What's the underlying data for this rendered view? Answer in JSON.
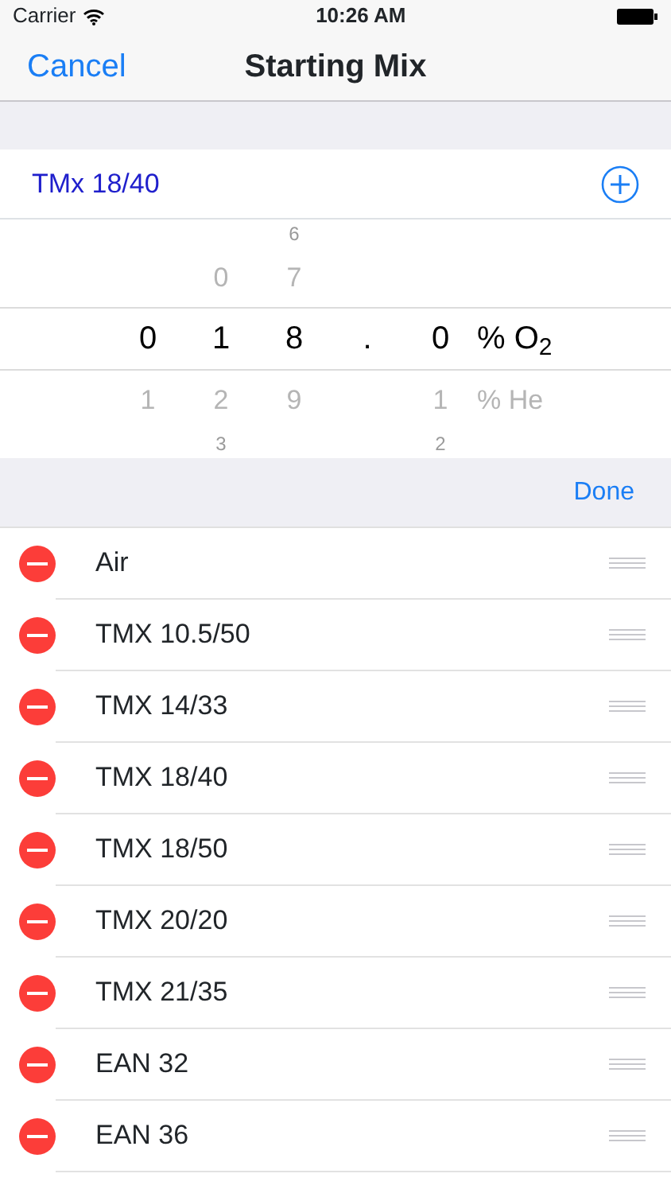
{
  "status_bar": {
    "carrier": "Carrier",
    "time": "10:26 AM"
  },
  "nav": {
    "cancel": "Cancel",
    "title": "Starting Mix"
  },
  "current_mix": {
    "label": "TMx 18/40"
  },
  "picker": {
    "rows": [
      {
        "kind": "far",
        "cells": [
          "",
          "",
          "6",
          "",
          "",
          ""
        ]
      },
      {
        "kind": "near",
        "cells": [
          "",
          "0",
          "7",
          "",
          "",
          ""
        ]
      },
      {
        "kind": "center",
        "cells": [
          "0",
          "1",
          "8",
          ".",
          "0",
          "% O$_{2}$"
        ]
      },
      {
        "kind": "near",
        "cells": [
          "1",
          "2",
          "9",
          "",
          "1",
          "% He"
        ]
      },
      {
        "kind": "far",
        "cells": [
          "",
          "3",
          "",
          "",
          "2",
          ""
        ]
      }
    ]
  },
  "list_header": {
    "done": "Done"
  },
  "mixes": [
    {
      "name": "Air"
    },
    {
      "name": "TMX 10.5/50"
    },
    {
      "name": "TMX 14/33"
    },
    {
      "name": "TMX 18/40"
    },
    {
      "name": "TMX 18/50"
    },
    {
      "name": "TMX 20/20"
    },
    {
      "name": "TMX 21/35"
    },
    {
      "name": "EAN 32"
    },
    {
      "name": "EAN 36"
    }
  ]
}
